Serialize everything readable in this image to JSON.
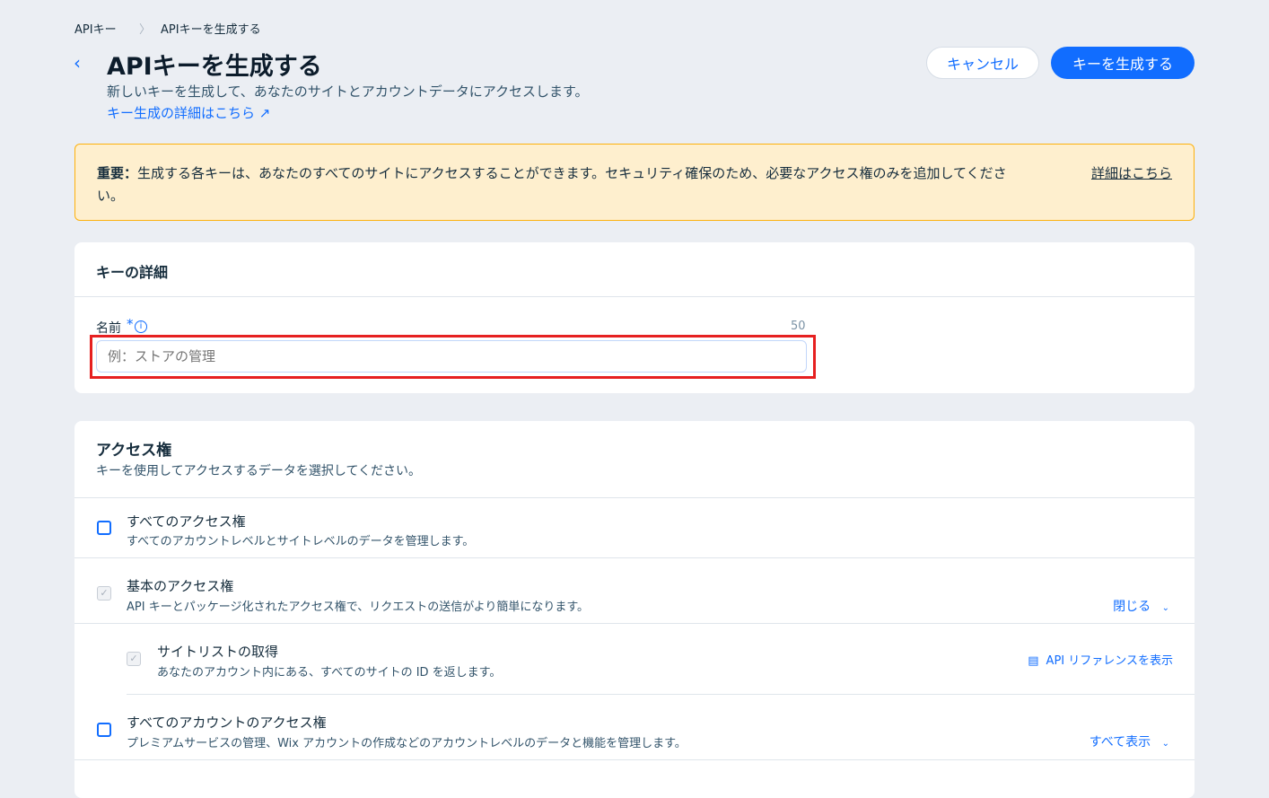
{
  "breadcrumb": {
    "root": "APIキー",
    "current": "APIキーを生成する"
  },
  "header": {
    "title": "APIキーを生成する",
    "subtitle": "新しいキーを生成して、あなたのサイトとアカウントデータにアクセスします。",
    "learn_link": "キー生成の詳細はこちら",
    "cancel": "キャンセル",
    "generate": "キーを生成する"
  },
  "notice": {
    "bold": "重要：",
    "text": "生成する各キーは、あなたのすべてのサイトにアクセスすることができます。セキュリティ確保のため、必要なアクセス権のみを追加してくださ",
    "text2": "い。",
    "link": "詳細はこちら"
  },
  "details": {
    "title": "キーの詳細",
    "name_label": "名前",
    "required": "*",
    "max": "50",
    "placeholder": "例：ストアの管理"
  },
  "access": {
    "title": "アクセス権",
    "subtitle": "キーを使用してアクセスするデータを選択してください。",
    "items": [
      {
        "title": "すべてのアクセス権",
        "desc": "すべてのアカウントレベルとサイトレベルのデータを管理します。"
      },
      {
        "title": "基本のアクセス権",
        "desc": "API キーとパッケージ化されたアクセス権で、リクエストの送信がより簡単になります。",
        "action": "閉じる"
      },
      {
        "title": "サイトリストの取得",
        "desc": "あなたのアカウント内にある、すべてのサイトの ID を返します。",
        "action": "API リファレンスを表示"
      },
      {
        "title": "すべてのアカウントのアクセス権",
        "desc": "プレミアムサービスの管理、Wix アカウントの作成などのアカウントレベルのデータと機能を管理します。",
        "action": "すべて表示"
      }
    ]
  },
  "colors": {
    "accent": "#116dff",
    "highlight": "#e62020",
    "notice_bg": "#feefce"
  }
}
